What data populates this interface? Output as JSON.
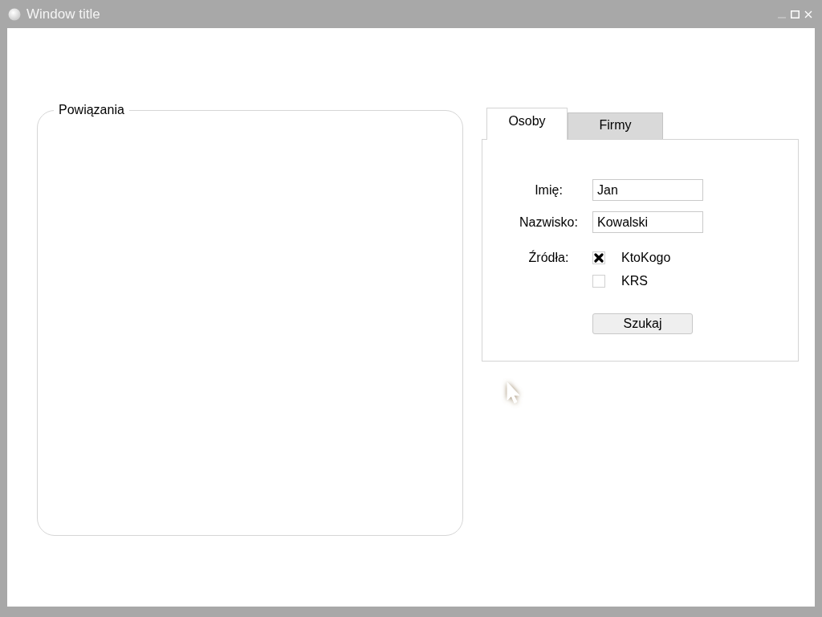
{
  "window": {
    "title": "Window title"
  },
  "group": {
    "title": "Powiązania"
  },
  "tabs": [
    {
      "label": "Osoby",
      "selected": true
    },
    {
      "label": "Firmy",
      "selected": false
    }
  ],
  "form": {
    "fields": [
      {
        "label": "Imię:",
        "value": "Jan"
      },
      {
        "label": "Nazwisko:",
        "value": "Kowalski"
      }
    ],
    "sources": {
      "label": "Źródła:",
      "options": [
        {
          "label": "KtoKogo",
          "checked": true
        },
        {
          "label": "KRS",
          "checked": false
        }
      ]
    },
    "button": "Szukaj"
  }
}
